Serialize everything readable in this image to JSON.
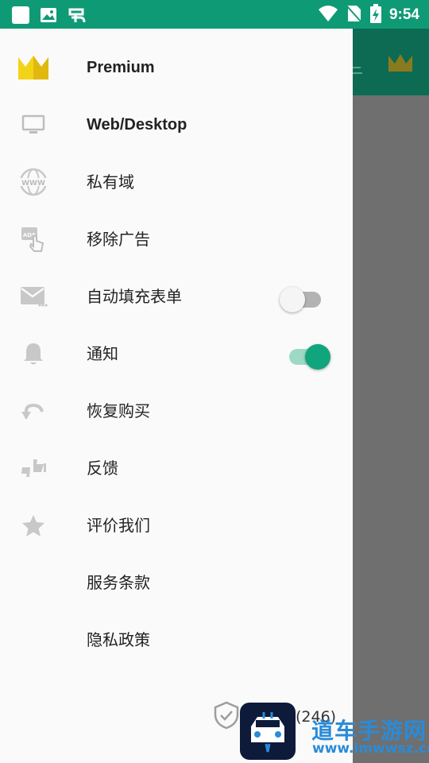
{
  "status_bar": {
    "time": "9:54"
  },
  "drawer": {
    "items": [
      {
        "label": "Premium",
        "icon": "crown-icon"
      },
      {
        "label": "Web/Desktop",
        "icon": "monitor-icon"
      },
      {
        "label": "私有域",
        "icon": "www-globe-icon"
      },
      {
        "label": "移除广告",
        "icon": "ads-tap-icon"
      },
      {
        "label": "自动填充表单",
        "icon": "mail-icon"
      },
      {
        "label": "通知",
        "icon": "bell-icon"
      },
      {
        "label": "恢复购买",
        "icon": "undo-icon"
      },
      {
        "label": "反馈",
        "icon": "thumbs-icon"
      },
      {
        "label": "评价我们",
        "icon": "star-icon"
      },
      {
        "label": "服务条款"
      },
      {
        "label": "隐私政策"
      }
    ],
    "toggles": {
      "autofill": false,
      "notifications": true
    },
    "footer": {
      "count": "(246)",
      "icon": "shield-check-icon"
    }
  },
  "watermark": {
    "text": "道车手游网",
    "url": "www.lmwwsz.com",
    "icon": "car-logo-icon"
  },
  "colors": {
    "primary": "#0f9a76",
    "accent": "#10a57d",
    "crown": "#f3d315"
  }
}
